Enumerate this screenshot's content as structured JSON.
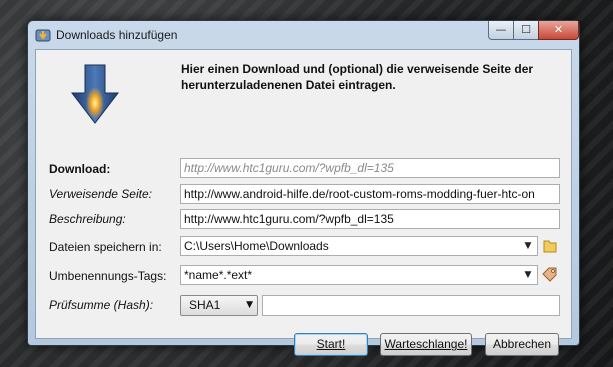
{
  "window": {
    "title": "Downloads hinzufügen",
    "minimize": "—",
    "maximize": "☐",
    "close": "✕"
  },
  "intro_text": "Hier einen Download und (optional) die verweisende Seite der herunterzuladenenen Datei eintragen.",
  "form": {
    "download_label": "Download:",
    "download_placeholder": "http://www.htc1guru.com/?wpfb_dl=135",
    "referer_label": "Verweisende Seite:",
    "referer_value": "http://www.android-hilfe.de/root-custom-roms-modding-fuer-htc-on",
    "description_label": "Beschreibung:",
    "description_value": "http://www.htc1guru.com/?wpfb_dl=135",
    "save_label": "Dateien speichern in:",
    "save_value": "C:\\Users\\Home\\Downloads",
    "rename_label": "Umbenennungs-Tags:",
    "rename_value": "*name*.*ext*",
    "checksum_label": "Prüfsumme (Hash):",
    "checksum_type": "SHA1",
    "checksum_value": ""
  },
  "icons": {
    "app": "download-app-icon",
    "arrow": "download-arrow-icon",
    "folder": "folder-icon",
    "tag": "tag-icon"
  },
  "buttons": {
    "start": "Start!",
    "queue": "Warteschlange!",
    "cancel": "Abbrechen"
  },
  "colors": {
    "arrow_blue": "#2a4f86",
    "arrow_glow": "#f5a623",
    "title_close": "#c7483a"
  }
}
